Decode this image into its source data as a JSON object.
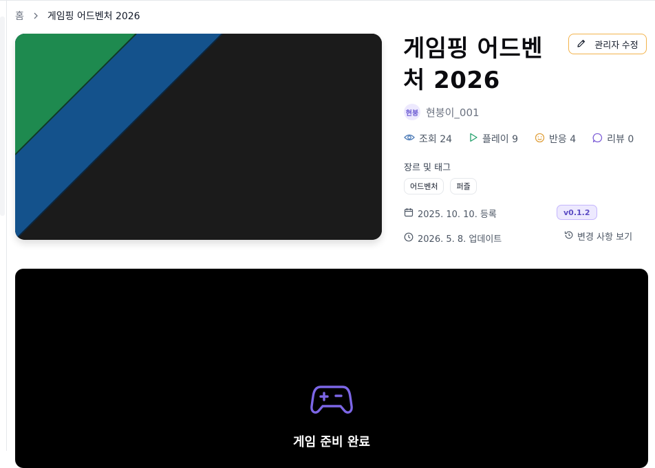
{
  "breadcrumb": {
    "home": "홈",
    "current": "게임핑 어드벤처 2026"
  },
  "game": {
    "title_line1": "게임핑 어드벤",
    "title_line2": "처 2026"
  },
  "admin_button": {
    "label": "관리자 수정",
    "icon": "pencil-icon"
  },
  "author": {
    "avatar_text": "현붕",
    "name": "현붕이_001"
  },
  "stats": {
    "views": "조회 24",
    "plays": "플레이 9",
    "reactions": "반응 4",
    "reviews": "리뷰 0"
  },
  "genre_section": {
    "label": "장르 및 태그",
    "tags": [
      "어드벤처",
      "퍼즐"
    ]
  },
  "dates": {
    "registered": "2025. 10. 10. 등록",
    "updated": "2026. 5. 8. 업데이트"
  },
  "version": "v0.1.2",
  "changelog_label": "변경 사항 보기",
  "player": {
    "status": "게임 준비 완료",
    "icon": "gamepad-icon"
  },
  "colors": {
    "hero_green": "#1e8a4f",
    "hero_blue": "#14528c",
    "hero_dark": "#1b1b1b",
    "accent_purple": "#6d5dd3",
    "admin_border": "#f2b24a"
  }
}
